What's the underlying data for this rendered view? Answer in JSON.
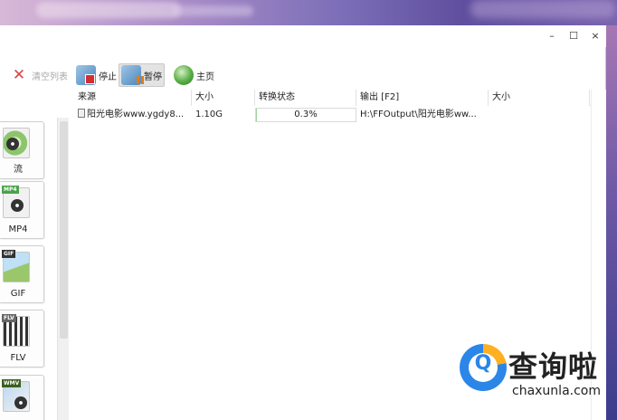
{
  "window": {
    "controls": {
      "minimize": "–",
      "maximize": "☐",
      "close": "×"
    }
  },
  "toolbar": {
    "clear_list": "清空列表",
    "stop": "停止",
    "pause": "暂停",
    "home": "主页"
  },
  "formats": [
    {
      "label": "流",
      "tag": ""
    },
    {
      "label": "MP4",
      "tag": "MP4"
    },
    {
      "label": "GIF",
      "tag": "GIF"
    },
    {
      "label": "FLV",
      "tag": "FLV"
    },
    {
      "label": "",
      "tag": "WMV"
    }
  ],
  "table": {
    "columns": [
      "来源",
      "大小",
      "转换状态",
      "输出 [F2]",
      "大小"
    ],
    "rows": [
      {
        "source": "阳光电影www.ygdy8...",
        "size": "1.10G",
        "status": "0.3%",
        "progress": 0.003,
        "output": "H:\\FFOutput\\阳光电影ww...",
        "out_size": ""
      }
    ]
  },
  "watermark": {
    "icon_letter": "Q",
    "cn": "查询啦",
    "en": "chaxunla.com"
  },
  "colors": {
    "progress_fill": "#9fd39f",
    "watermark_blue": "#2b86e8",
    "watermark_orange": "#ffb020"
  }
}
